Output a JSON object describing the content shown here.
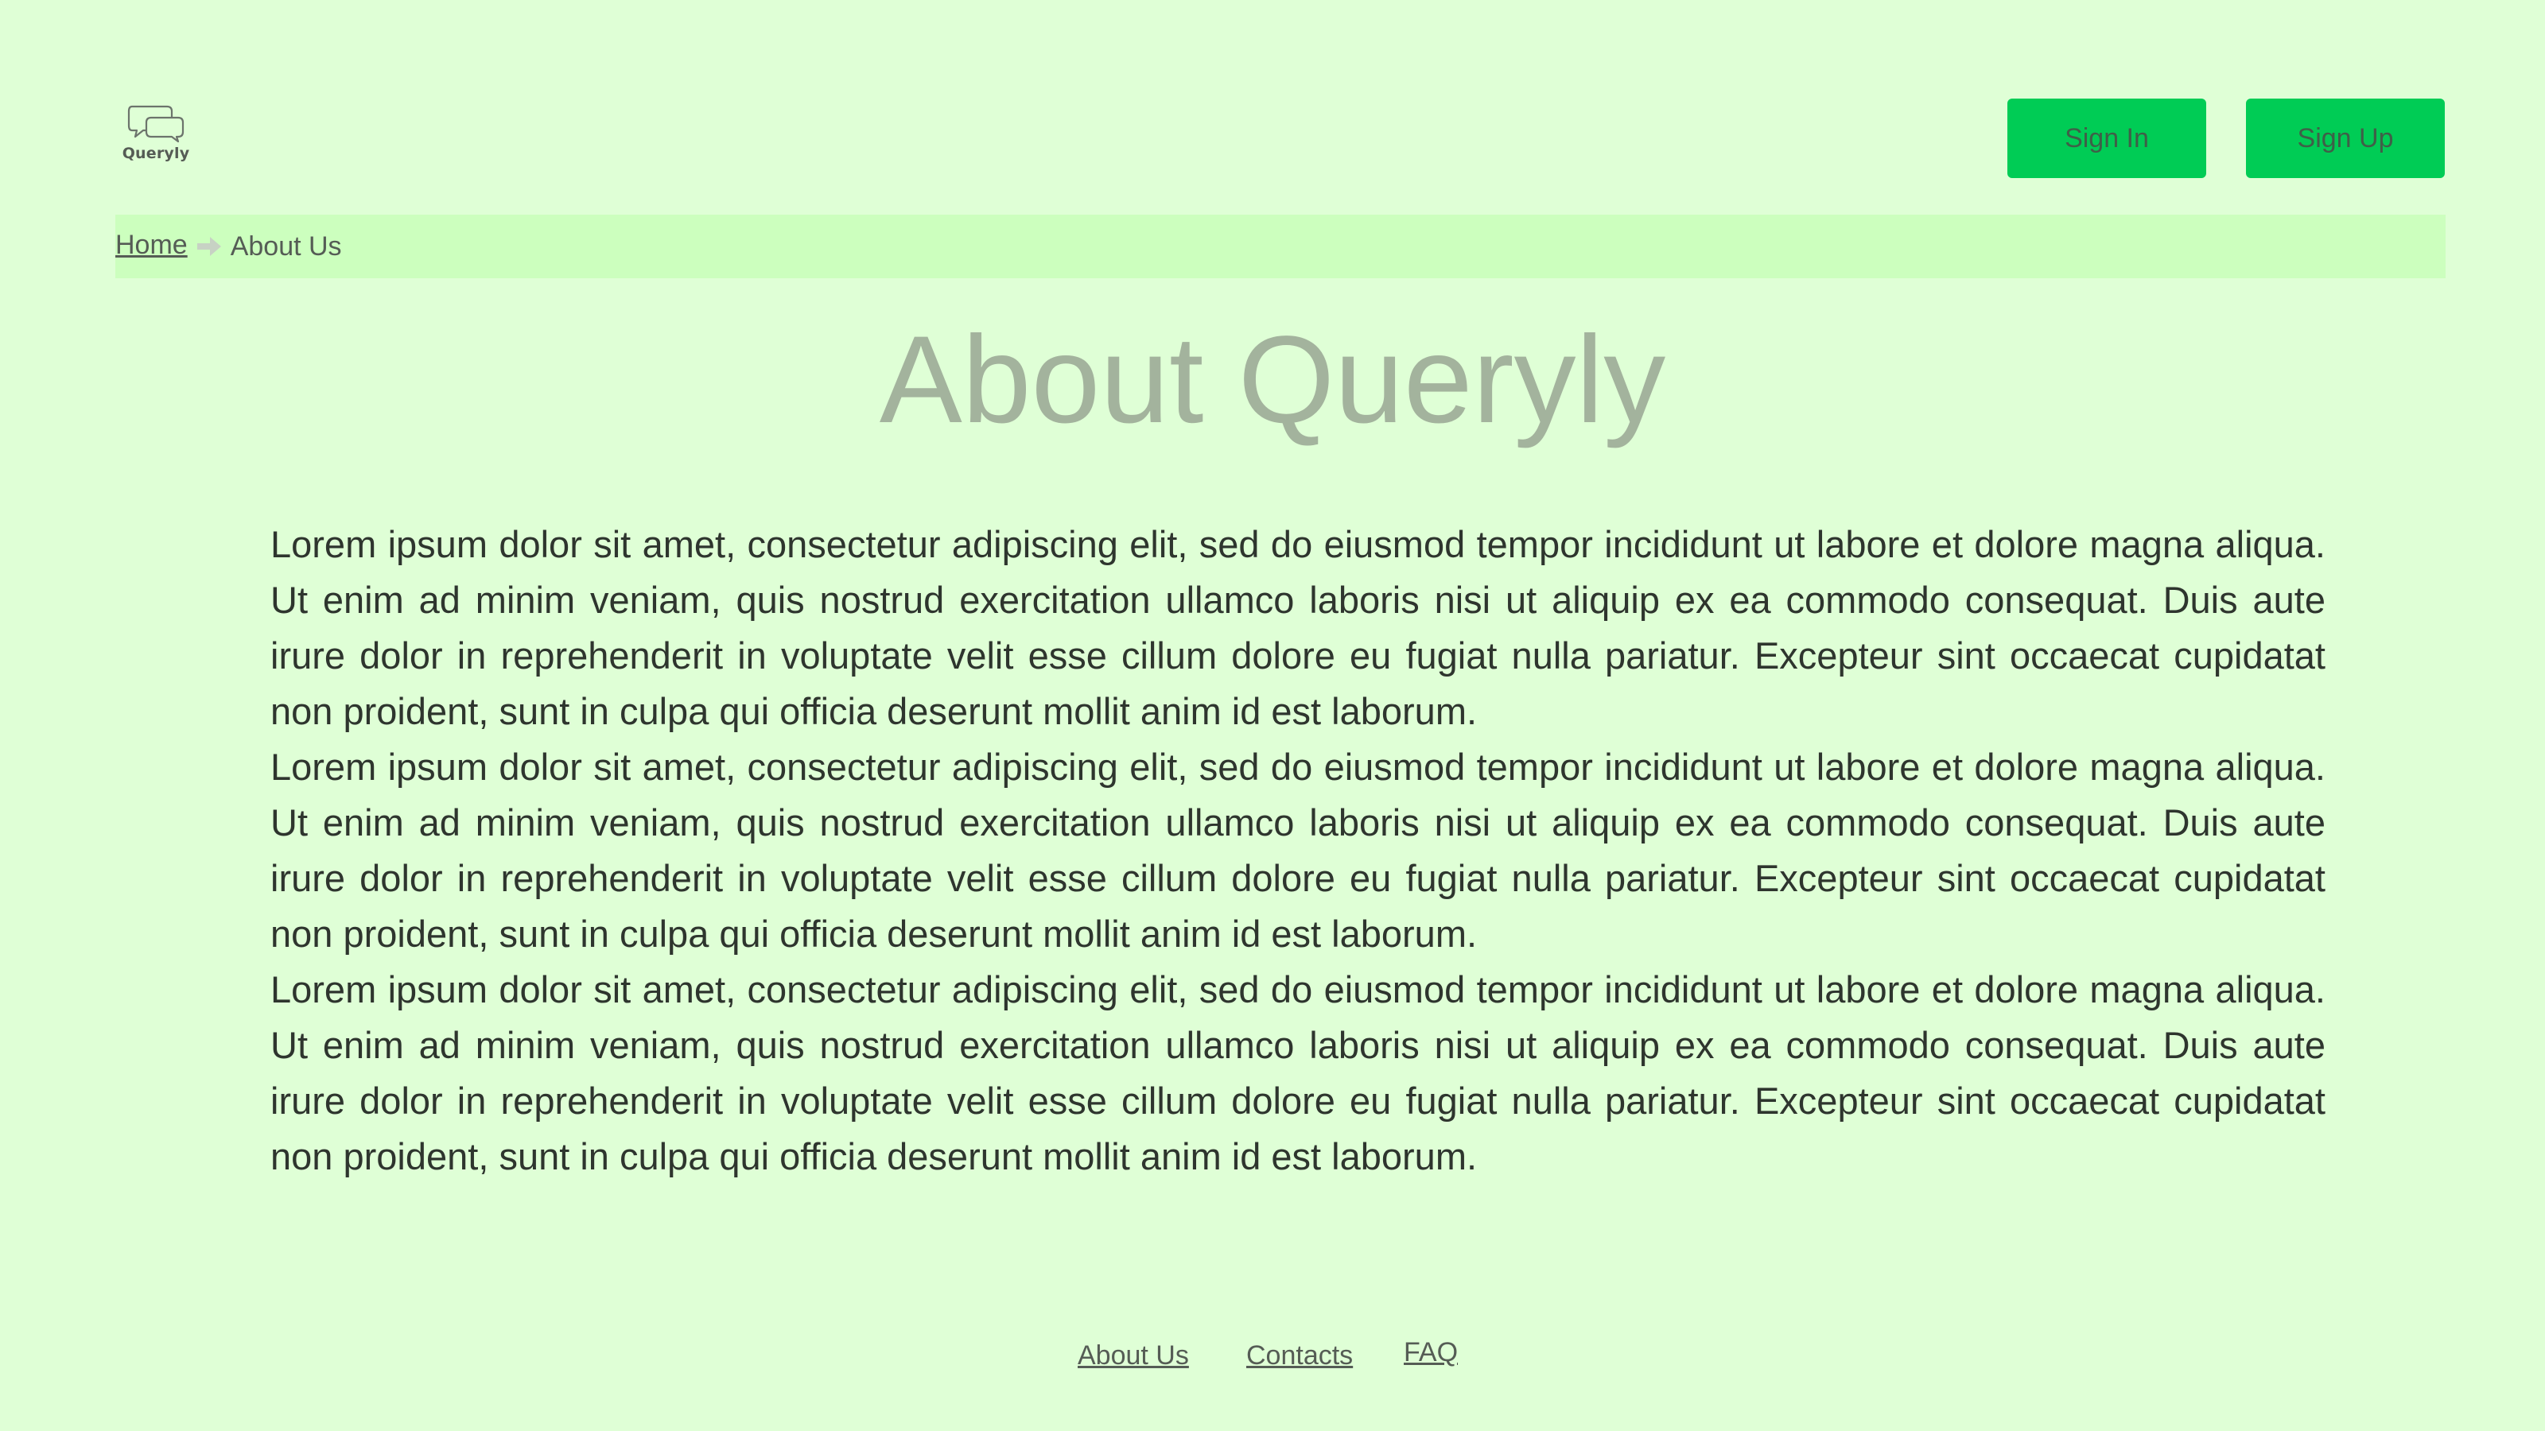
{
  "header": {
    "logo_text": "Queryly",
    "sign_in_label": "Sign In",
    "sign_up_label": "Sign Up"
  },
  "breadcrumb": {
    "home_label": "Home",
    "current_label": "About Us",
    "separator_icon": "arrow-right-icon"
  },
  "main": {
    "title": "About Queryly",
    "paragraphs": [
      "Lorem ipsum dolor sit amet, consectetur adipiscing elit, sed do eiusmod tempor incididunt ut labore et dolore magna aliqua. Ut enim ad minim veniam, quis nostrud exercitation ullamco laboris nisi ut aliquip ex ea commodo consequat. Duis aute irure dolor in reprehenderit in voluptate velit esse cillum dolore eu fugiat nulla pariatur. Excepteur sint occaecat cupidatat non proident, sunt in culpa qui officia deserunt mollit anim id est laborum.",
      "Lorem ipsum dolor sit amet, consectetur adipiscing elit, sed do eiusmod tempor incididunt ut labore et dolore magna aliqua. Ut enim ad minim veniam, quis nostrud exercitation ullamco laboris nisi ut aliquip ex ea commodo consequat. Duis aute irure dolor in reprehenderit in voluptate velit esse cillum dolore eu fugiat nulla pariatur. Excepteur sint occaecat cupidatat non proident, sunt in culpa qui officia deserunt mollit anim id est laborum.",
      "Lorem ipsum dolor sit amet, consectetur adipiscing elit, sed do eiusmod tempor incididunt ut labore et dolore magna aliqua. Ut enim ad minim veniam, quis nostrud exercitation ullamco laboris nisi ut aliquip ex ea commodo consequat. Duis aute irure dolor in reprehenderit in voluptate velit esse cillum dolore eu fugiat nulla pariatur. Excepteur sint occaecat cupidatat non proident, sunt in culpa qui officia deserunt mollit anim id est laborum."
    ]
  },
  "footer": {
    "links": [
      "About Us",
      "Contacts",
      "FAQ"
    ]
  },
  "colors": {
    "background": "#dfffd6",
    "breadcrumb_bg": "#ccffbe",
    "button_bg": "#00cc55",
    "title_color": "#a3b39d",
    "text_color": "#2e352e"
  }
}
